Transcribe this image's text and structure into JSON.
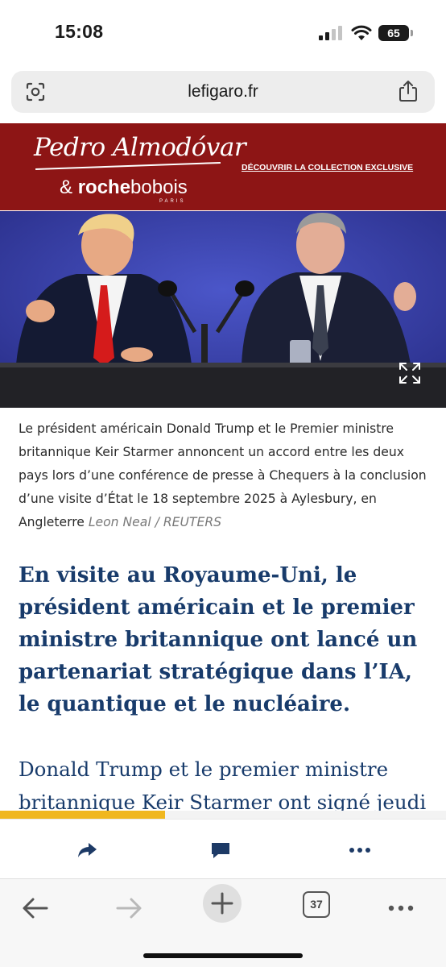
{
  "status_bar": {
    "time": "15:08",
    "battery": "65"
  },
  "address_bar": {
    "url": "lefigaro.fr"
  },
  "ad": {
    "script_name": "Pedro Almodóvar",
    "ampersand": "&",
    "brand_bold": "roche",
    "brand_light": "bobois",
    "brand_sub": "PARIS",
    "cta": "DÉCOUVRIR LA COLLECTION EXCLUSIVE",
    "colors": {
      "background": "#8d1515"
    }
  },
  "photo": {
    "description_icon": "expand-icon"
  },
  "caption": {
    "text": "Le président américain Donald Trump et le Premier ministre britannique Keir Starmer annoncent un accord entre les deux pays lors d’une conférence de presse à Chequers à la conclusion d’une visite d’État le 18 septembre 2025 à Aylesbury, en Angleterre",
    "credit": "Leon Neal / REUTERS"
  },
  "article": {
    "headline": "En visite au Royaume-Uni, le président américain et le premier ministre britannique ont lancé un partenariat stratégique dans l’IA, le quantique et le nucléaire.",
    "body_start": "Donald Trump et le premier ministre britannique Keir Starmer ont signé jeudi"
  },
  "reading_progress": {
    "fraction": 0.37,
    "color": "#f0b71e"
  },
  "action_bar": {
    "icons": [
      "share-icon",
      "comment-icon",
      "more-icon"
    ],
    "color": "#1d3a66"
  },
  "browser_toolbar": {
    "tab_count": "37",
    "icons": [
      "back-arrow-icon",
      "forward-arrow-icon",
      "new-tab-plus-icon",
      "tabs-icon",
      "menu-more-icon"
    ]
  },
  "colors": {
    "headline": "#183b6b",
    "accent": "#f0b71e"
  }
}
